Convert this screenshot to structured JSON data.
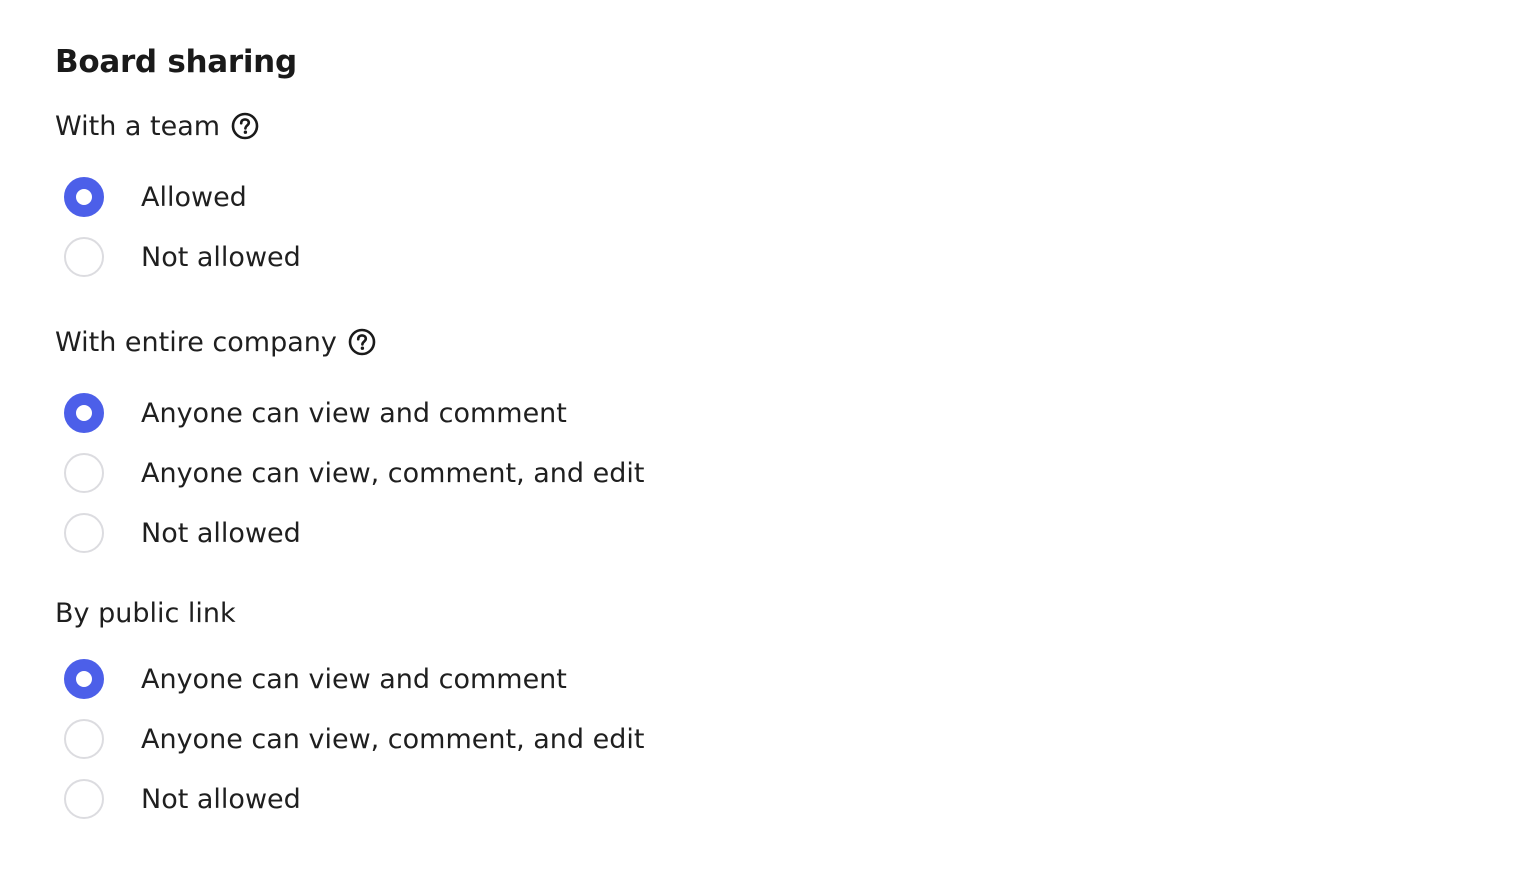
{
  "title": "Board sharing",
  "accent_color": "#4c5fe9",
  "sections": [
    {
      "label": "With a team",
      "help_icon": "question-circle-icon",
      "options": [
        {
          "label": "Allowed",
          "selected": true
        },
        {
          "label": "Not allowed",
          "selected": false
        }
      ]
    },
    {
      "label": "With entire company",
      "help_icon": "question-circle-icon",
      "options": [
        {
          "label": "Anyone can view and comment",
          "selected": true
        },
        {
          "label": "Anyone can view, comment, and edit",
          "selected": false
        },
        {
          "label": "Not allowed",
          "selected": false
        }
      ]
    },
    {
      "label": "By public link",
      "options": [
        {
          "label": "Anyone can view and comment",
          "selected": true
        },
        {
          "label": "Anyone can view, comment, and edit",
          "selected": false
        },
        {
          "label": "Not allowed",
          "selected": false
        }
      ]
    }
  ]
}
